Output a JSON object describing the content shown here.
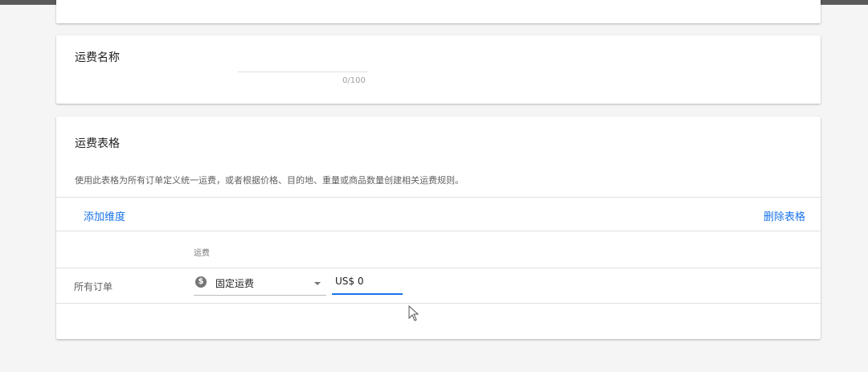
{
  "shipping_name": {
    "title": "运费名称",
    "char_count": "0/100"
  },
  "shipping_table": {
    "title": "运费表格",
    "description": "使用此表格为所有订单定义统一运费，或者根据价格、目的地、重量或商品数量创建相关运费规则。",
    "add_dimension_label": "添加维度",
    "delete_table_label": "删除表格",
    "column_header": "运费",
    "row": {
      "label": "所有订单",
      "rate_type": {
        "icon": "dollar-icon",
        "selected": "固定运费"
      },
      "price_value": "US$ 0"
    }
  },
  "colors": {
    "accent": "#1a73e8",
    "background": "#f5f5f5",
    "card": "#ffffff"
  }
}
